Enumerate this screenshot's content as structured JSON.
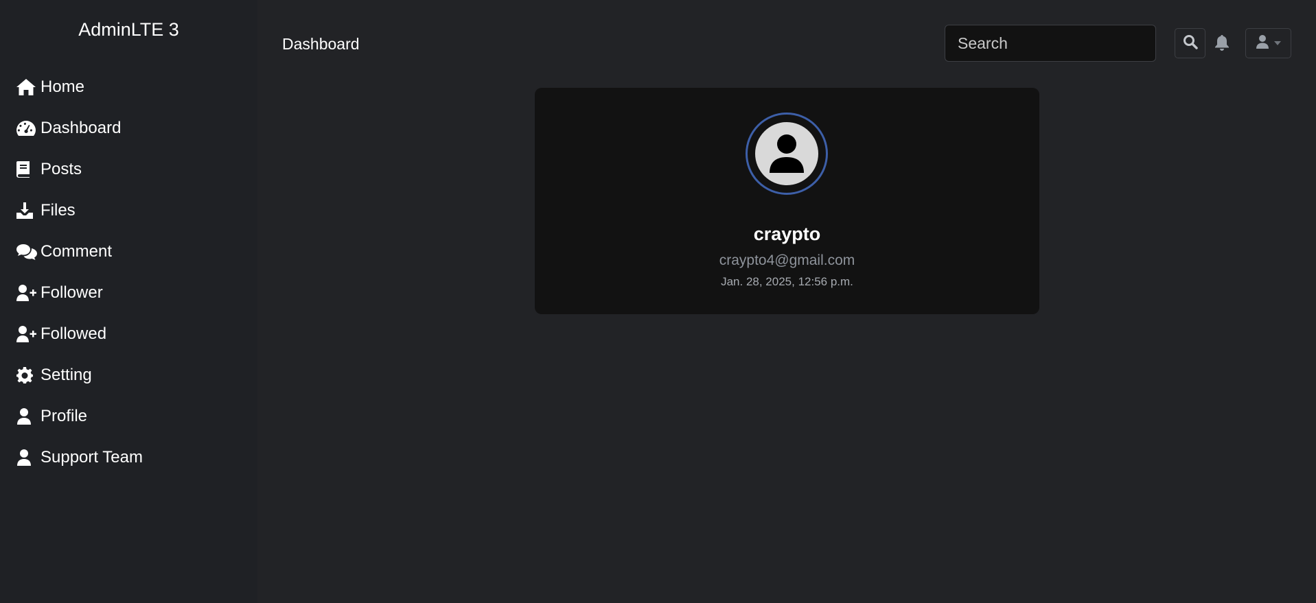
{
  "brand": "AdminLTE 3",
  "sidebar": {
    "items": [
      {
        "label": "Home",
        "icon": "home-icon"
      },
      {
        "label": "Dashboard",
        "icon": "tachometer-icon"
      },
      {
        "label": "Posts",
        "icon": "book-icon"
      },
      {
        "label": "Files",
        "icon": "download-icon"
      },
      {
        "label": "Comment",
        "icon": "comments-icon"
      },
      {
        "label": "Follower",
        "icon": "user-plus-icon"
      },
      {
        "label": "Followed",
        "icon": "user-plus-icon"
      },
      {
        "label": "Setting",
        "icon": "gear-icon"
      },
      {
        "label": "Profile",
        "icon": "user-icon"
      },
      {
        "label": "Support Team",
        "icon": "user-icon"
      }
    ]
  },
  "header": {
    "title": "Dashboard",
    "search_placeholder": "Search"
  },
  "profile": {
    "username": "craypto",
    "email": "craypto4@gmail.com",
    "joined": "Jan. 28, 2025, 12:56 p.m."
  },
  "colors": {
    "background": "#222326",
    "sidebar": "#1f2125",
    "card": "#121212",
    "avatar_ring": "#3d5fa8",
    "muted_text": "#8e939b"
  }
}
